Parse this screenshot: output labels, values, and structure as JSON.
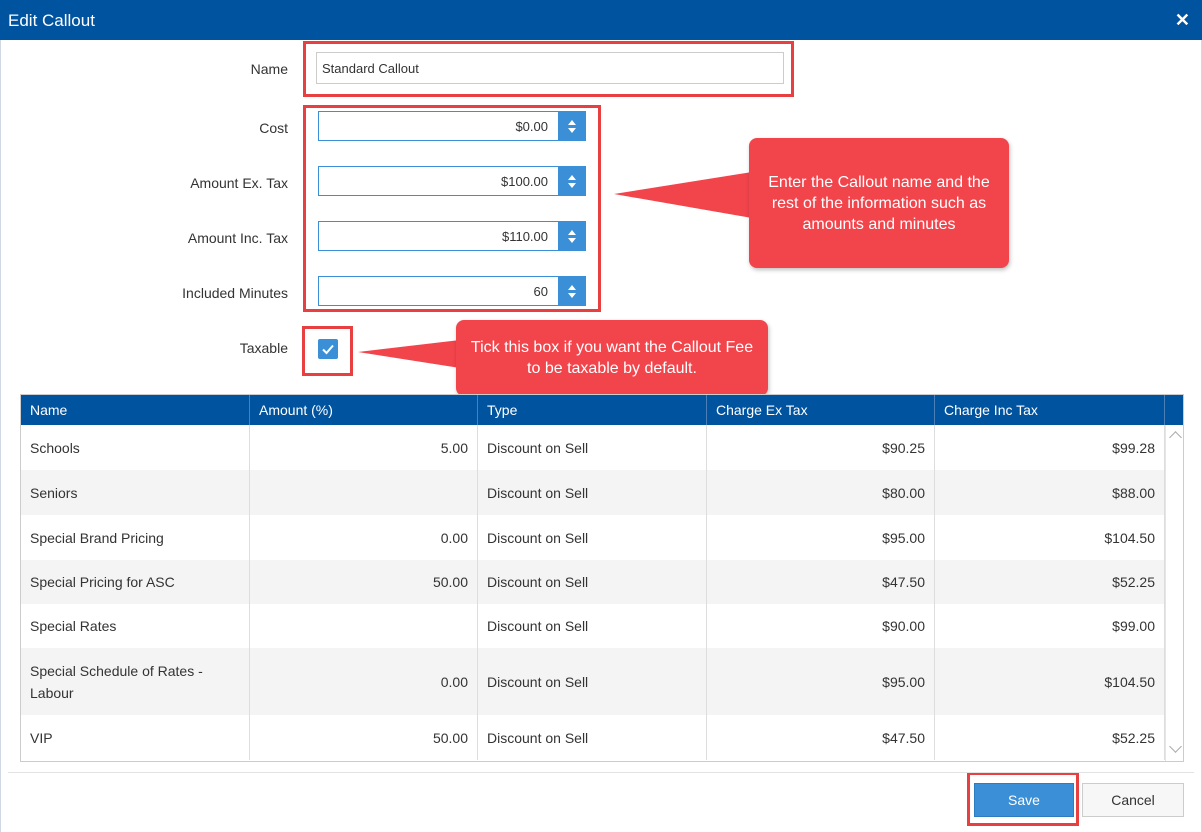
{
  "window": {
    "title": "Edit Callout"
  },
  "form": {
    "name_label": "Name",
    "name_value": "Standard Callout",
    "cost_label": "Cost",
    "cost_value": "$0.00",
    "amount_ex_label": "Amount Ex. Tax",
    "amount_ex_value": "$100.00",
    "amount_inc_label": "Amount Inc. Tax",
    "amount_inc_value": "$110.00",
    "minutes_label": "Included Minutes",
    "minutes_value": "60",
    "taxable_label": "Taxable",
    "taxable_checked": true
  },
  "callouts": {
    "fields_note": "Enter the Callout name and the rest of the information such as amounts and minutes",
    "taxable_note": "Tick this box if you want the Callout Fee to be taxable by default."
  },
  "table": {
    "headers": [
      "Name",
      "Amount (%)",
      "Type",
      "Charge Ex Tax",
      "Charge Inc Tax"
    ],
    "rows": [
      [
        "Schools",
        "5.00",
        "Discount on Sell",
        "$90.25",
        "$99.28"
      ],
      [
        "Seniors",
        "",
        "Discount on Sell",
        "$80.00",
        "$88.00"
      ],
      [
        "Special Brand Pricing",
        "0.00",
        "Discount on Sell",
        "$95.00",
        "$104.50"
      ],
      [
        "Special Pricing for ASC",
        "50.00",
        "Discount on Sell",
        "$47.50",
        "$52.25"
      ],
      [
        "Special Rates",
        "",
        "Discount on Sell",
        "$90.00",
        "$99.00"
      ],
      [
        "Special Schedule of Rates - Labour",
        "0.00",
        "Discount on Sell",
        "$95.00",
        "$104.50"
      ],
      [
        "VIP",
        "50.00",
        "Discount on Sell",
        "$47.50",
        "$52.25"
      ]
    ]
  },
  "footer": {
    "save_label": "Save",
    "cancel_label": "Cancel"
  },
  "colors": {
    "primary": "#00539f",
    "accent": "#3a8fd6",
    "highlight": "#e84040",
    "callout": "#f2444b"
  }
}
